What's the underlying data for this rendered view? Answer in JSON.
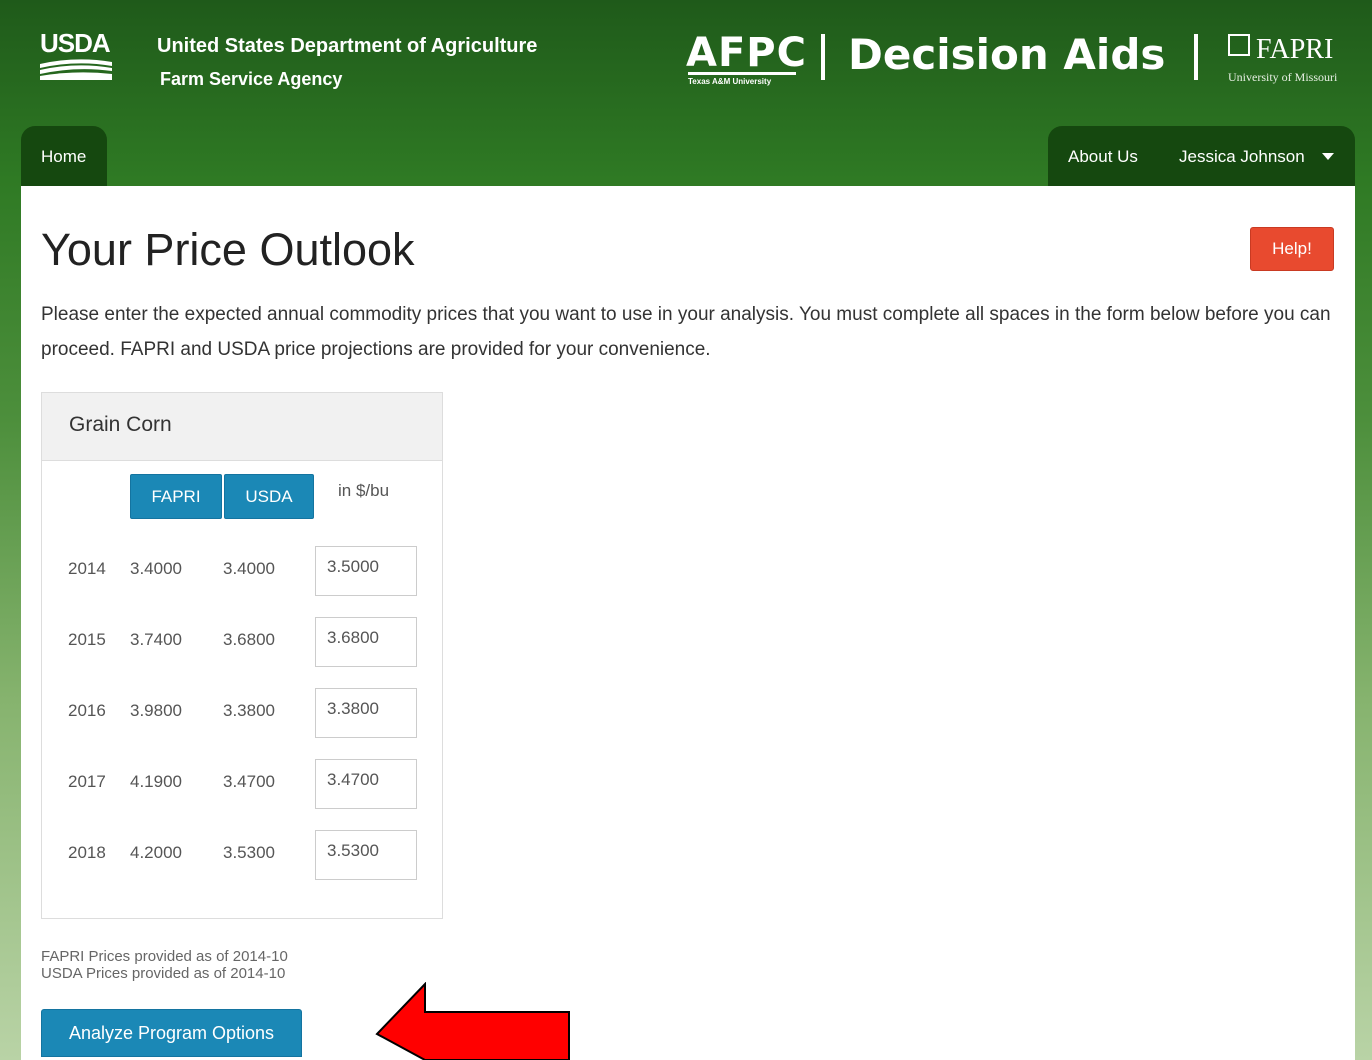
{
  "header": {
    "usda_logo_text": "USDA",
    "dept_title": "United States Department of Agriculture",
    "agency": "Farm Service Agency",
    "afpc_logo_text": "AFPC",
    "afpc_subtitle": "Texas A&M University",
    "app_title": "Decision Aids",
    "fapri_logo_text": "FAPRI",
    "fapri_subtitle": "University of Missouri"
  },
  "nav": {
    "home": "Home",
    "about": "About Us",
    "user": "Jessica Johnson"
  },
  "page": {
    "title": "Your Price Outlook",
    "help": "Help!",
    "intro": "Please enter the expected annual commodity prices that you want to use in your analysis. You must complete all spaces in the form below before you can proceed. FAPRI and USDA price projections are provided for your convenience."
  },
  "panel": {
    "title": "Grain Corn",
    "fapri_button": "FAPRI",
    "usda_button": "USDA",
    "unit": "in $/bu",
    "rows": [
      {
        "year": "2014",
        "fapri": "3.4000",
        "usda": "3.4000",
        "value": "3.5000"
      },
      {
        "year": "2015",
        "fapri": "3.7400",
        "usda": "3.6800",
        "value": "3.6800"
      },
      {
        "year": "2016",
        "fapri": "3.9800",
        "usda": "3.3800",
        "value": "3.3800"
      },
      {
        "year": "2017",
        "fapri": "4.1900",
        "usda": "3.4700",
        "value": "3.4700"
      },
      {
        "year": "2018",
        "fapri": "4.2000",
        "usda": "3.5300",
        "value": "3.5300"
      }
    ]
  },
  "footer": {
    "fapri_asof": "FAPRI Prices provided as of 2014-10",
    "usda_asof": "USDA Prices provided as of 2014-10",
    "analyze": "Analyze Program Options"
  },
  "colors": {
    "header_green": "#2f7a24",
    "tab_green": "#15480f",
    "primary_blue": "#1b88b6",
    "help_red": "#e84a2f",
    "arrow_red": "#ff0000"
  }
}
